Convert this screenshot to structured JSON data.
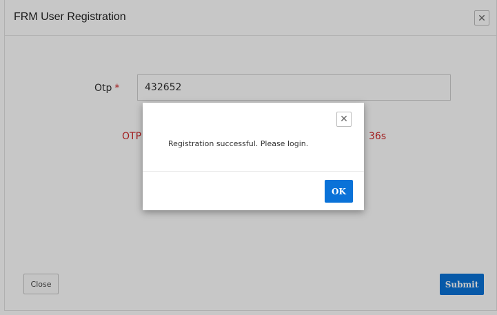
{
  "registration_modal": {
    "title": "FRM User Registration",
    "close_icon": "close-icon",
    "otp": {
      "label": "Otp",
      "required_mark": "*",
      "value": "432652",
      "message_left": "OTP",
      "message_right": "36s"
    },
    "close_button_label": "Close",
    "submit_button_label": "Submit"
  },
  "alert_dialog": {
    "close_icon": "close-icon",
    "message": "Registration successful. Please login.",
    "ok_button_label": "OK"
  },
  "colors": {
    "primary": "#0a72d8",
    "error": "#d0282a"
  }
}
